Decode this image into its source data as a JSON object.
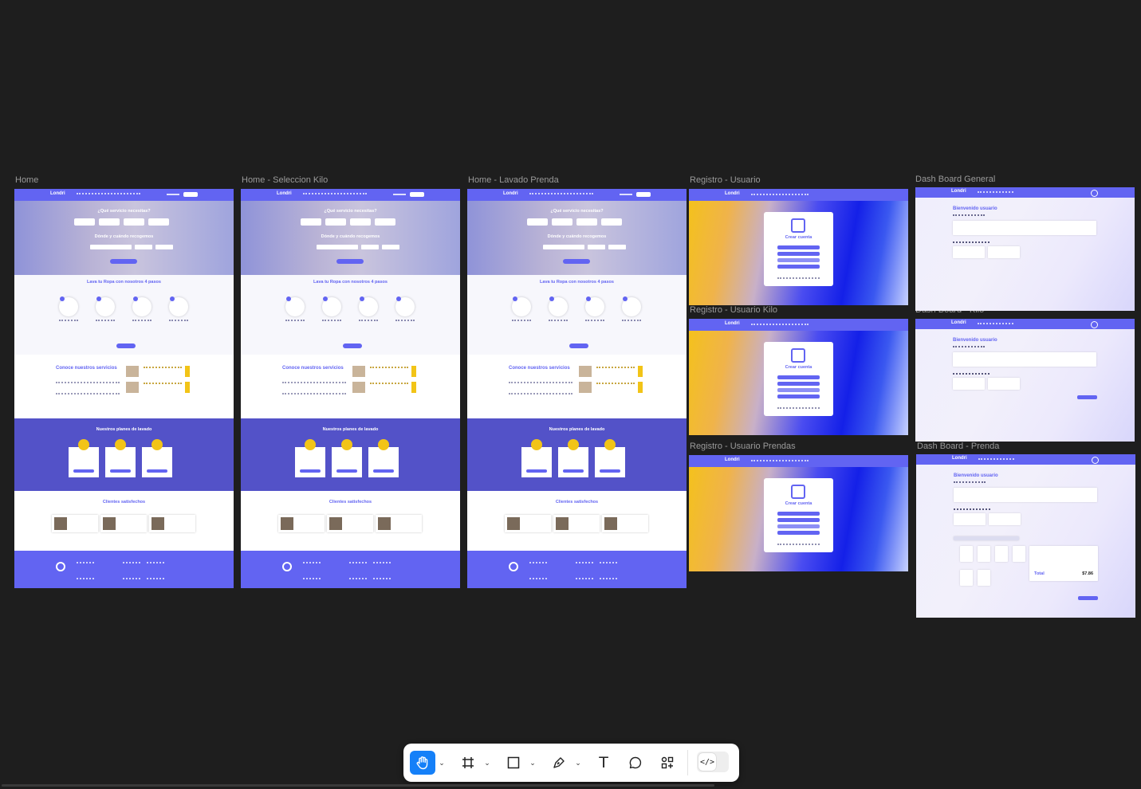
{
  "frames": {
    "home": "Home",
    "home_kilo": "Home - Seleccion Kilo",
    "home_prenda": "Home - Lavado Prenda",
    "registro_usuario": "Registro - Usuario",
    "registro_kilo": "Registro - Usuario Kilo",
    "registro_prendas": "Registro - Usuario Prendas",
    "dashboard_general": "Dash Board General",
    "dashboard_kilo": "Dash Board - Kilo",
    "dashboard_prenda": "Dash Board - Prenda"
  },
  "home_content": {
    "brand": "Londri",
    "hero_title": "¿Qué servicio necesitas?",
    "hero_sub": "Dónde y cuándo recogemos",
    "steps_title": "Lava tu Ropa con nosotros 4 pasos",
    "services_title": "Conoce nuestros servicios",
    "plans_title": "Nuestros planes de lavado",
    "clients_title": "Clientes satisfechos"
  },
  "registro_content": {
    "brand": "Londri",
    "card_title": "Crear cuenta"
  },
  "dashboard_content": {
    "brand": "Londri",
    "welcome": "Bienvenido usuario",
    "total_label": "Total",
    "total_value": "$7.86"
  },
  "toolbar": {
    "tools": [
      {
        "name": "hand-tool",
        "icon": "hand-icon",
        "active": true
      },
      {
        "name": "frame-tool",
        "icon": "frame-icon"
      },
      {
        "name": "rectangle-tool",
        "icon": "rectangle-icon"
      },
      {
        "name": "pen-tool",
        "icon": "pen-icon"
      },
      {
        "name": "text-tool",
        "icon": "text-icon",
        "glyph": "T"
      },
      {
        "name": "comment-tool",
        "icon": "comment-icon"
      },
      {
        "name": "components-tool",
        "icon": "components-icon"
      },
      {
        "name": "dev-mode-toggle",
        "icon": "code-icon"
      }
    ]
  },
  "colors": {
    "canvas": "#1e1e1e",
    "brand": "#6264f2",
    "accent": "#f2c417",
    "toolbar_active": "#1580f8"
  }
}
